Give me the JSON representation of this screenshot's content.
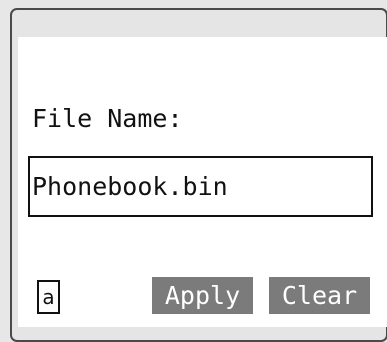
{
  "form": {
    "label": "File Name:",
    "file_name_value": "Phonebook.bin",
    "input_mode": "a"
  },
  "buttons": {
    "apply_label": "Apply",
    "clear_label": "Clear"
  },
  "colors": {
    "background": "#e7e7e7",
    "panel": "#ffffff",
    "button": "#7b7b7b",
    "button_text": "#ffffff",
    "border": "#111111"
  }
}
